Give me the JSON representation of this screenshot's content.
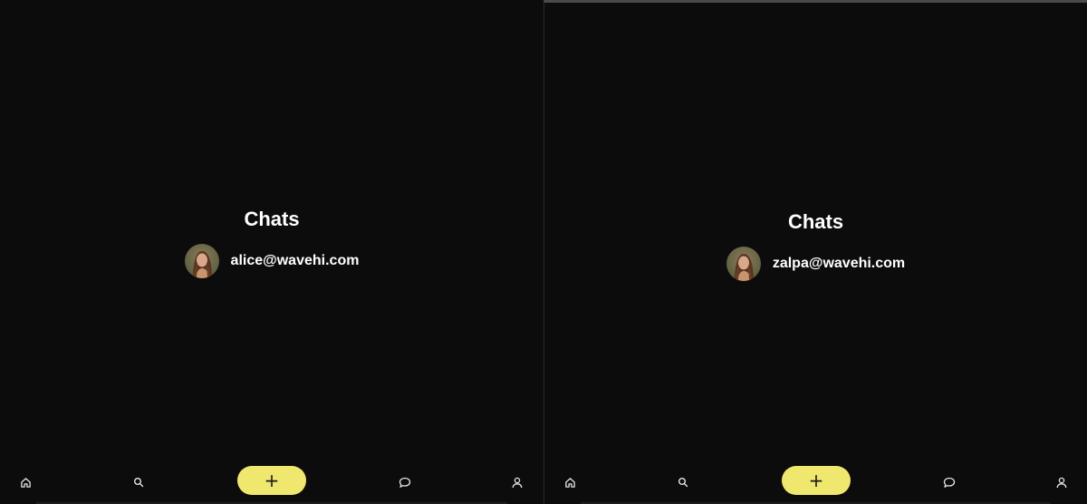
{
  "screens": [
    {
      "title": "Chats",
      "chats": [
        {
          "name": "alice@wavehi.com",
          "avatar_icon": "avatar-photo"
        }
      ]
    },
    {
      "title": "Chats",
      "chats": [
        {
          "name": "zalpa@wavehi.com",
          "avatar_icon": "avatar-photo"
        }
      ]
    }
  ],
  "nav": {
    "items": [
      "home-icon",
      "search-icon",
      "add-button",
      "chat-icon",
      "profile-icon"
    ],
    "add_label": "+"
  },
  "colors": {
    "background": "#0d0c0d",
    "accent": "#f0e86e",
    "text": "#ffffff"
  }
}
